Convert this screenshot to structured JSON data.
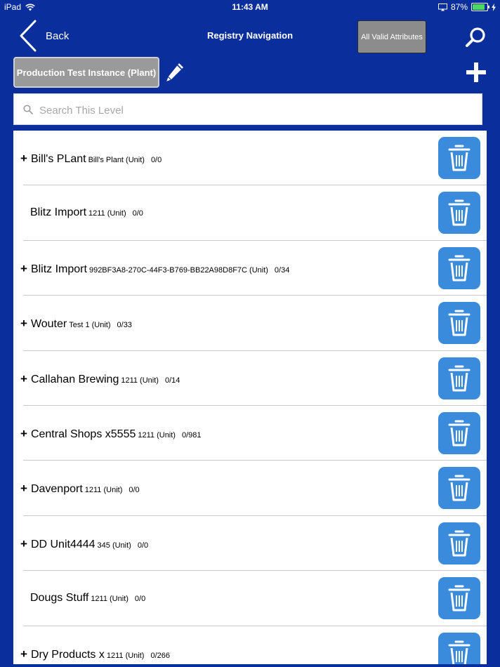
{
  "status_bar": {
    "device": "iPad",
    "time": "11:43 AM",
    "battery": "87%"
  },
  "nav": {
    "back_label": "Back",
    "title": "Registry Navigation",
    "attributes_label": "All Valid Attributes"
  },
  "instance": {
    "label": "Production Test Instance (Plant)"
  },
  "search": {
    "placeholder": "Search This Level",
    "value": ""
  },
  "colors": {
    "background": "#0a2f9c",
    "trash_button": "#3a8bdc",
    "instance_button": "#9a9a9a"
  },
  "rows": [
    {
      "name": "Bill's PLant",
      "sub": "Bill's Plant (Unit)",
      "count": "0/0",
      "expander": "+"
    },
    {
      "name": "Blitz Import",
      "sub": "1211 (Unit)",
      "count": "0/0",
      "expander": ""
    },
    {
      "name": "Blitz Import",
      "sub": "992BF3A8-270C-44F3-B769-BB22A98D8F7C (Unit)",
      "count": "0/34",
      "expander": "+"
    },
    {
      "name": "Wouter",
      "sub": "Test 1 (Unit)",
      "count": "0/33",
      "expander": "+"
    },
    {
      "name": "Callahan Brewing",
      "sub": "1211 (Unit)",
      "count": "0/14",
      "expander": "+"
    },
    {
      "name": "Central Shops x5555",
      "sub": "1211 (Unit)",
      "count": "0/981",
      "expander": "+"
    },
    {
      "name": "Davenport",
      "sub": "1211 (Unit)",
      "count": "0/0",
      "expander": "+"
    },
    {
      "name": "DD Unit4444",
      "sub": "345 (Unit)",
      "count": "0/0",
      "expander": "+"
    },
    {
      "name": "Dougs Stuff",
      "sub": "1211 (Unit)",
      "count": "0/0",
      "expander": ""
    },
    {
      "name": "Dry Products x",
      "sub": "1211 (Unit)",
      "count": "0/266",
      "expander": "+"
    }
  ]
}
